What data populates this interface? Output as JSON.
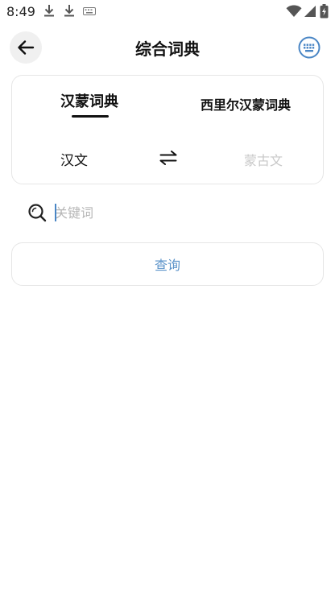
{
  "status_bar": {
    "time": "8:49",
    "icons": [
      "download-icon",
      "download-icon",
      "keyboard-icon",
      "wifi-icon",
      "signal-icon",
      "battery-icon"
    ]
  },
  "header": {
    "title": "综合词典",
    "back_icon": "arrow-left-icon",
    "keyboard_icon": "keyboard-icon"
  },
  "dictionary": {
    "tabs": [
      {
        "label": "汉蒙词典",
        "selected": true
      },
      {
        "label": "西里尔汉蒙词典",
        "selected": false
      }
    ],
    "source_language": "汉文",
    "target_language": "蒙古文",
    "swap_icon": "swap-arrows-icon"
  },
  "search": {
    "placeholder": "关键词",
    "value": "",
    "icon": "search-icon"
  },
  "query_button": {
    "label": "查询"
  },
  "colors": {
    "accent": "#5b93c9",
    "title": "#111111",
    "placeholder": "#b6b6b6",
    "disabled_text": "#c8c8c8",
    "border": "#e6e6e6",
    "icon_blue": "#4a86c5"
  }
}
